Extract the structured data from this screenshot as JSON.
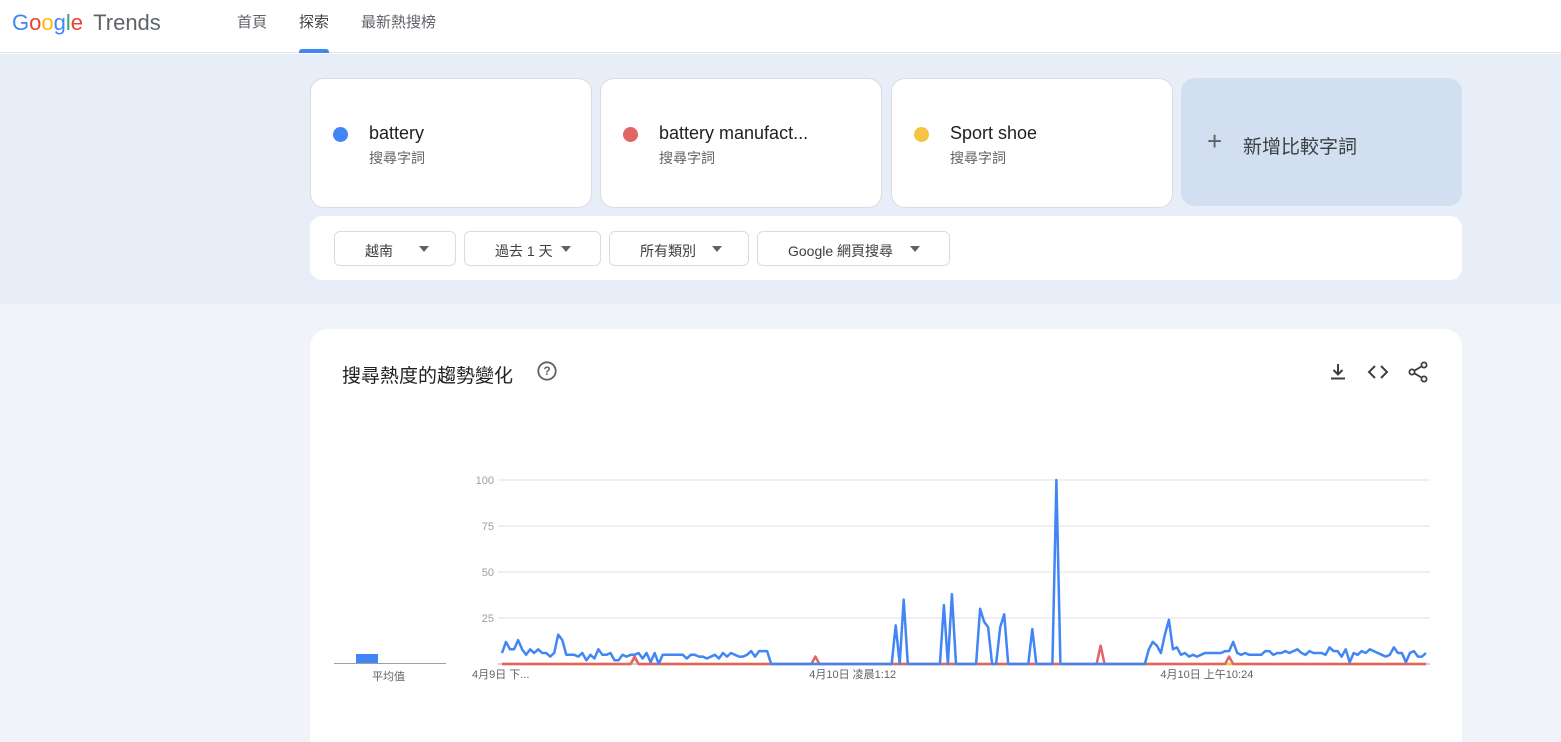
{
  "header": {
    "logo_google": "Google",
    "logo_trends": "Trends",
    "nav": [
      "首頁",
      "探索",
      "最新熱搜榜"
    ],
    "active_nav_index": 1
  },
  "terms": [
    {
      "name": "battery",
      "sub": "搜尋字詞",
      "color": "#4285f4"
    },
    {
      "name": "battery manufact...",
      "sub": "搜尋字詞",
      "color": "#e06666"
    },
    {
      "name": "Sport shoe",
      "sub": "搜尋字詞",
      "color": "#f6c343"
    }
  ],
  "add_compare": {
    "label": "新增比較字詞",
    "icon": "plus-icon"
  },
  "filters": {
    "region": "越南",
    "time": "過去 1 天",
    "category": "所有類別",
    "search_type": "Google 網頁搜尋"
  },
  "chart_section": {
    "title": "搜尋熱度的趨勢變化",
    "icons": [
      "help-icon",
      "download-icon",
      "embed-icon",
      "share-icon"
    ],
    "average_label": "平均值"
  },
  "chart_data": {
    "type": "line",
    "title": "",
    "xlabel": "",
    "ylabel": "",
    "ylim": [
      0,
      100
    ],
    "yticks": [
      100,
      75,
      50,
      25
    ],
    "xtick_labels": [
      "4月9日 下...",
      "4月10日 凌晨1:12",
      "4月10日 上午10:24"
    ],
    "grid": true,
    "averages": {
      "battery": 5,
      "battery manufact...": 0,
      "Sport shoe": 0
    },
    "series": [
      {
        "name": "battery",
        "color": "#4285f4",
        "values": [
          6,
          12,
          8,
          8,
          13,
          8,
          5,
          8,
          6,
          8,
          6,
          6,
          4,
          6,
          16,
          13,
          5,
          5,
          5,
          4,
          6,
          2,
          5,
          3,
          8,
          5,
          5,
          6,
          2,
          2,
          5,
          4,
          5,
          5,
          6,
          3,
          6,
          1,
          6,
          0,
          5,
          5,
          5,
          5,
          5,
          5,
          3,
          5,
          5,
          4,
          4,
          3,
          4,
          5,
          3,
          6,
          4,
          6,
          5,
          4,
          4,
          5,
          7,
          4,
          7,
          7,
          7,
          0,
          0,
          0,
          0,
          0,
          0,
          0,
          0,
          0,
          0,
          0,
          0,
          0,
          0,
          0,
          0,
          0,
          0,
          0,
          0,
          0,
          0,
          0,
          0,
          0,
          0,
          0,
          0,
          0,
          0,
          0,
          21,
          0,
          35,
          0,
          0,
          0,
          0,
          0,
          0,
          0,
          0,
          0,
          32,
          0,
          38,
          0,
          0,
          0,
          0,
          0,
          0,
          30,
          23,
          20,
          0,
          0,
          20,
          27,
          0,
          0,
          0,
          0,
          0,
          0,
          19,
          0,
          0,
          0,
          0,
          0,
          100,
          0,
          0,
          0,
          0,
          0,
          0,
          0,
          0,
          0,
          0,
          0,
          0,
          0,
          0,
          0,
          0,
          0,
          0,
          0,
          0,
          0,
          0,
          8,
          12,
          10,
          6,
          16,
          24,
          8,
          9,
          5,
          6,
          4,
          5,
          4,
          5,
          6,
          6,
          6,
          6,
          6,
          7,
          7,
          12,
          6,
          5,
          6,
          5,
          5,
          5,
          5,
          7,
          7,
          5,
          6,
          6,
          7,
          6,
          7,
          8,
          6,
          5,
          7,
          6,
          6,
          6,
          5,
          9,
          7,
          7,
          4,
          8,
          1,
          6,
          5,
          7,
          6,
          8,
          7,
          6,
          5,
          4,
          5,
          9,
          6,
          6,
          1,
          6,
          7,
          4,
          4,
          6
        ]
      },
      {
        "name": "battery manufact...",
        "color": "#e06666",
        "values": [
          0,
          0,
          0,
          0,
          0,
          0,
          0,
          0,
          0,
          0,
          0,
          0,
          0,
          0,
          0,
          0,
          0,
          0,
          0,
          0,
          0,
          0,
          0,
          0,
          0,
          0,
          0,
          0,
          0,
          0,
          0,
          0,
          0,
          0,
          0,
          0,
          0,
          0,
          0,
          0,
          0,
          0,
          0,
          0,
          0,
          0,
          0,
          0,
          0,
          0,
          0,
          0,
          0,
          0,
          0,
          0,
          0,
          0,
          0,
          0,
          0,
          0,
          0,
          0,
          0,
          0,
          0,
          0,
          0,
          0,
          0,
          0,
          0,
          0,
          0,
          0,
          0,
          0,
          0,
          0,
          0,
          0,
          0,
          0,
          0,
          0,
          0,
          0,
          0,
          0,
          0,
          0,
          0,
          0,
          0,
          0,
          0,
          0,
          0,
          0,
          0,
          0,
          0,
          0,
          0,
          0,
          0,
          0,
          0,
          0,
          0,
          0,
          0,
          0,
          0,
          0,
          0,
          0,
          0,
          0,
          0,
          0,
          0,
          0,
          0,
          0,
          0,
          0,
          0,
          0,
          0,
          0,
          0,
          0,
          0,
          0,
          0,
          0,
          0,
          0,
          0,
          0,
          0,
          0,
          0,
          0,
          0,
          0,
          0,
          0,
          0,
          0,
          0,
          0,
          0,
          0,
          0,
          0,
          0,
          0,
          0,
          0,
          0,
          0,
          0,
          0,
          0,
          0,
          0,
          0,
          0,
          0,
          0,
          0,
          0,
          0,
          0,
          0,
          0,
          0,
          0,
          0,
          0,
          0,
          0,
          0,
          0,
          0,
          0,
          0,
          0,
          0,
          0,
          0,
          0,
          0,
          0,
          0,
          0,
          0,
          0,
          0,
          0,
          0,
          0,
          0,
          0,
          0,
          0,
          0,
          0,
          0,
          0,
          0,
          0,
          0,
          0,
          0,
          0,
          0,
          0,
          0,
          0,
          0,
          0,
          0,
          0,
          0,
          0,
          0,
          0
        ]
      },
      {
        "name": "Sport shoe",
        "color": "#f6c343",
        "values": [
          0,
          0,
          0,
          0,
          0,
          0,
          0,
          0,
          0,
          0,
          0,
          0,
          0,
          0,
          0,
          0,
          0,
          0,
          0,
          0,
          0,
          0,
          0,
          0,
          0,
          0,
          0,
          0,
          0,
          0,
          0,
          0,
          0,
          0,
          0,
          0,
          0,
          0,
          0,
          0,
          0,
          0,
          0,
          0,
          0,
          0,
          0,
          0,
          0,
          0,
          0,
          0,
          0,
          0,
          0,
          0,
          0,
          0,
          0,
          0,
          0,
          0,
          0,
          0,
          0,
          0,
          0,
          0,
          0,
          0,
          0,
          0,
          0,
          0,
          0,
          0,
          0,
          0,
          0,
          0,
          0,
          0,
          0,
          0,
          0,
          0,
          0,
          0,
          0,
          0,
          0,
          0,
          0,
          0,
          0,
          0,
          0,
          0,
          0,
          0,
          0,
          0,
          0,
          0,
          0,
          0,
          0,
          0,
          0,
          0,
          0,
          0,
          0,
          0,
          0,
          0,
          0,
          0,
          0,
          0,
          0,
          0,
          0,
          0,
          0,
          0,
          0,
          0,
          0,
          0,
          0,
          0,
          0,
          0,
          0,
          0,
          0,
          0,
          0,
          0,
          0,
          0,
          0,
          0,
          0,
          0,
          0,
          0,
          0,
          0,
          0,
          0,
          0,
          0,
          0,
          0,
          0,
          0,
          0,
          0,
          0,
          0,
          0,
          0,
          0,
          0,
          0,
          0,
          0,
          0,
          0,
          0,
          0,
          0,
          0,
          0,
          0,
          0,
          0,
          0,
          0,
          0,
          0,
          0,
          0,
          0,
          0,
          0,
          0,
          0,
          0,
          0,
          0,
          0,
          0,
          0,
          0,
          0,
          0,
          0,
          0,
          0,
          0,
          0,
          0,
          0,
          0,
          0,
          0,
          0,
          0,
          0,
          0,
          0,
          0,
          0,
          0,
          0,
          0,
          0,
          0,
          0,
          0,
          0,
          0,
          0,
          0,
          0,
          0,
          0,
          0
        ]
      }
    ],
    "spikes": [
      {
        "series": "battery manufact...",
        "index": 33,
        "value": 4
      },
      {
        "series": "battery manufact...",
        "index": 78,
        "value": 4
      },
      {
        "series": "battery manufact...",
        "index": 149,
        "value": 10
      },
      {
        "series": "battery manufact...",
        "index": 181,
        "value": 4
      },
      {
        "series": "Sport shoe",
        "index": 33,
        "value": 3
      }
    ]
  }
}
